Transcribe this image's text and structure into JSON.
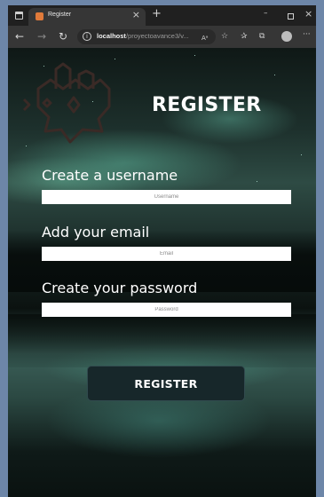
{
  "browser": {
    "tab_title": "Register",
    "tab_close": "×",
    "new_tab": "+",
    "url_host": "localhost",
    "url_path": "/proyectoavance3/v...",
    "read_aloud": "Aᵃ",
    "window_min": "–",
    "window_close": "×"
  },
  "form": {
    "title": "REGISTER",
    "username_label": "Create a username",
    "username_placeholder": "Username",
    "email_label": "Add your email",
    "email_placeholder": "Email",
    "password_label": "Create your password",
    "password_placeholder": "Password",
    "submit_label": "REGISTER"
  },
  "icons": {
    "back": "back-arrow-icon",
    "forward": "forward-arrow-icon",
    "reload": "reload-icon",
    "info": "info-icon",
    "favorite": "star-plus-icon",
    "favorites": "favorites-icon",
    "collections": "collections-icon",
    "profile": "profile-avatar-icon",
    "more": "more-dots-icon",
    "logo": "castle-logo-icon"
  },
  "colors": {
    "button_bg": "#17272a",
    "field_bg": "#ffffff",
    "logo_stroke": "#3a2a26"
  }
}
